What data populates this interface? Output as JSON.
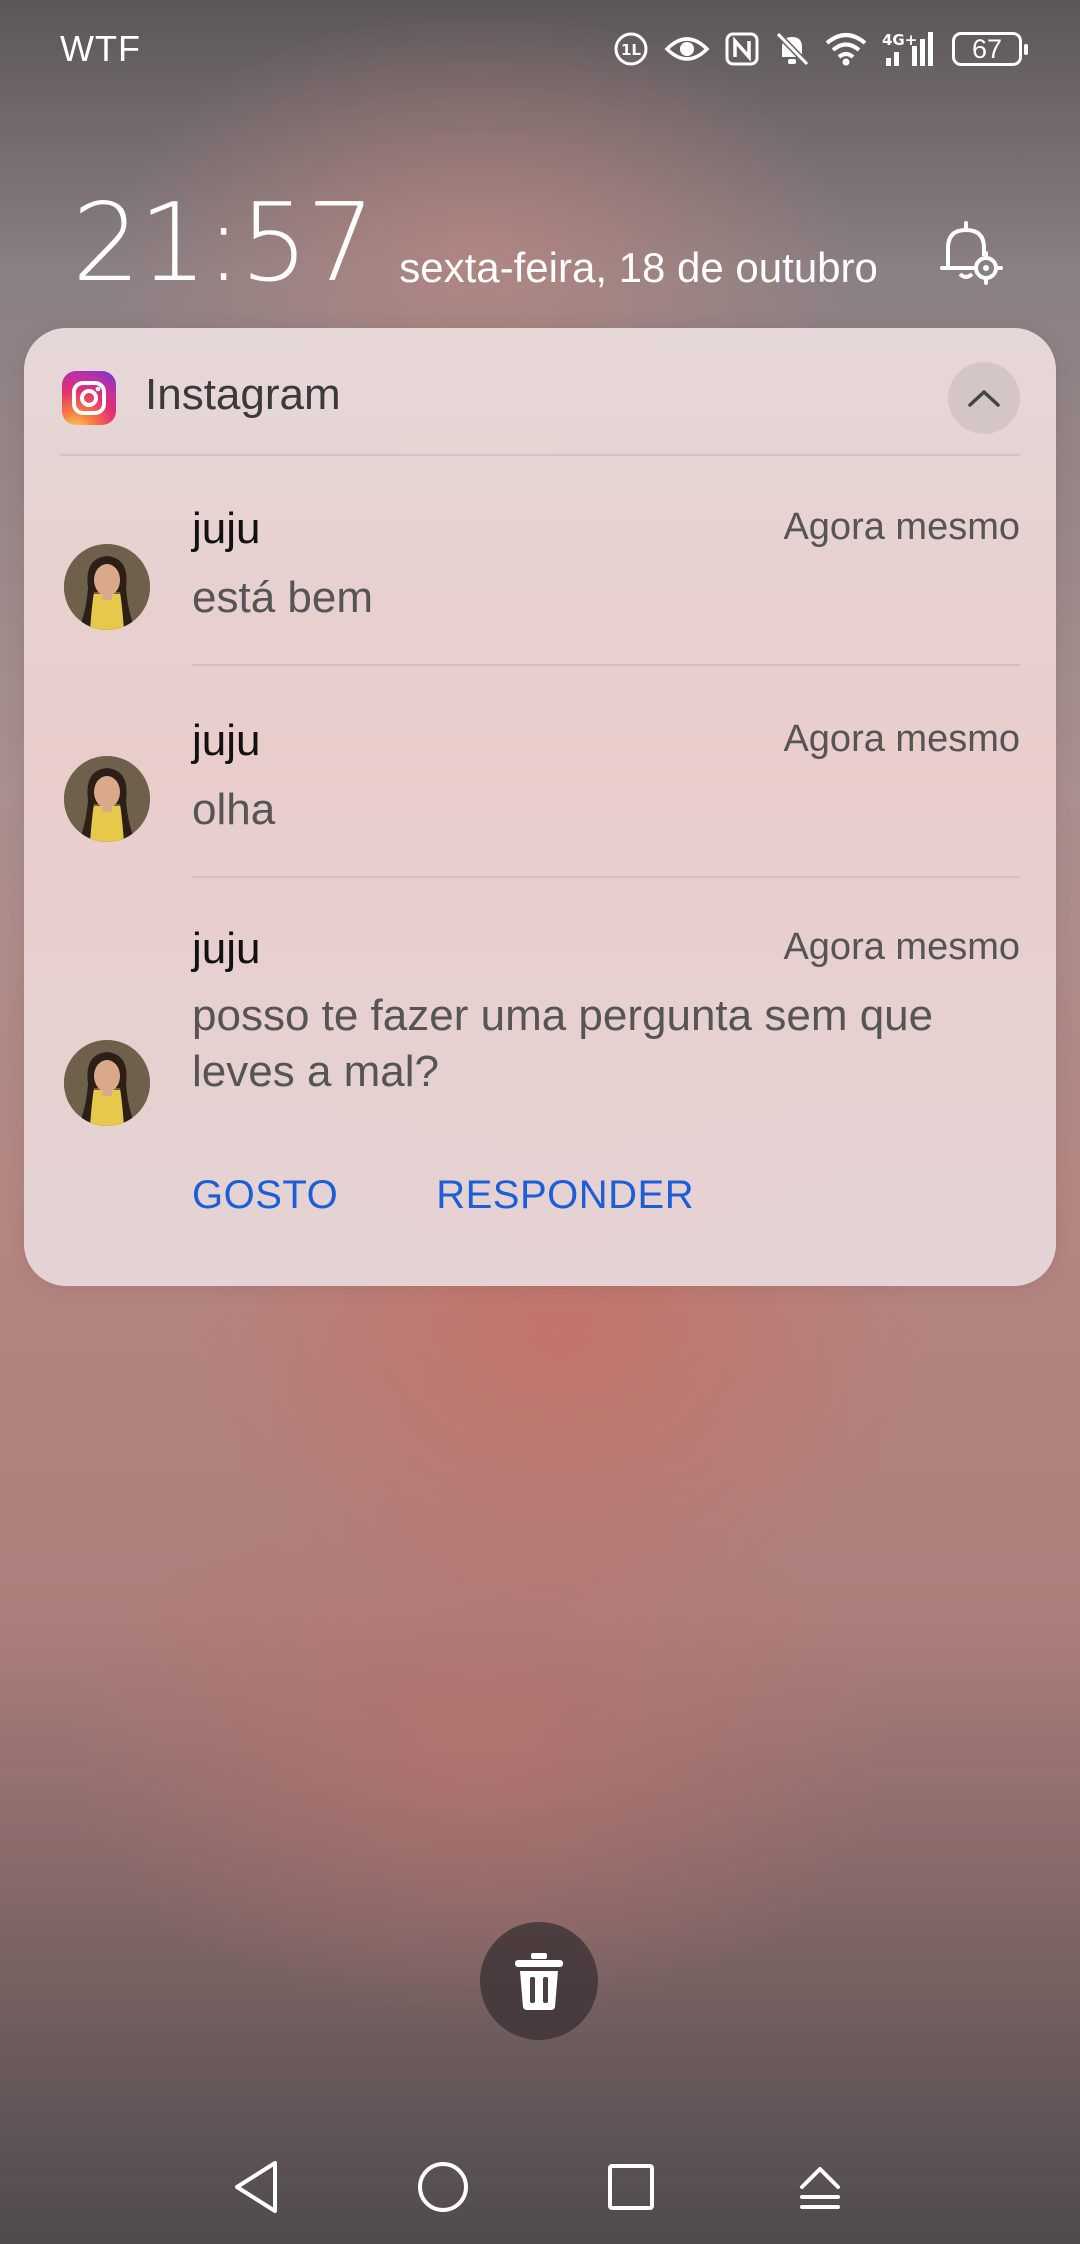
{
  "status_bar": {
    "carrier": "WTF",
    "battery": "67",
    "icons": [
      "data-saver-icon",
      "eye-comfort-icon",
      "nfc-icon",
      "mute-bell-icon",
      "wifi-icon",
      "4g-signal-icon",
      "battery-icon"
    ]
  },
  "lockscreen": {
    "time": "21:57",
    "date": "sexta-feira, 18 de outubro"
  },
  "notification": {
    "app_name": "Instagram",
    "messages": [
      {
        "sender": "juju",
        "time": "Agora mesmo",
        "text": "está bem"
      },
      {
        "sender": "juju",
        "time": "Agora mesmo",
        "text": "olha"
      },
      {
        "sender": "juju",
        "time": "Agora mesmo",
        "text": "posso te fazer uma pergunta sem que leves a mal?"
      }
    ],
    "actions": {
      "like": "GOSTO",
      "reply": "RESPONDER"
    }
  },
  "colors": {
    "action_blue": "#1a5ed8",
    "card_bg": "#ecdedd"
  }
}
